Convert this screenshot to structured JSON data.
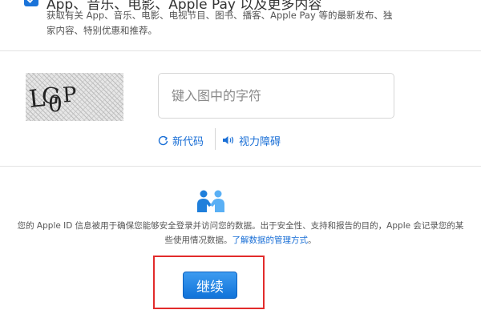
{
  "subscription_option": {
    "title": "App、音乐、电影、Apple Pay 以及更多内容",
    "description": "获取有关 App、音乐、电影、电视节目、图书、播客、Apple Pay 等的最新发布、独家内容、特别优惠和推荐。",
    "checked": true
  },
  "captcha": {
    "image_text": "LG0P",
    "input_placeholder": "键入图中的字符",
    "input_value": "",
    "new_code_label": "新代码",
    "accessibility_label": "视力障碍"
  },
  "privacy": {
    "text": "您的 Apple ID 信息被用于确保您能够安全登录并访问您的数据。出于安全性、支持和报告的目的，Apple 会记录您的某些使用情况数据。",
    "link_text": "了解数据的管理方式",
    "trailing": "。"
  },
  "continue_button": {
    "label": "继续"
  },
  "colors": {
    "accent": "#1a6fd6",
    "button": "#1173d9",
    "highlight": "#e22b2b"
  }
}
